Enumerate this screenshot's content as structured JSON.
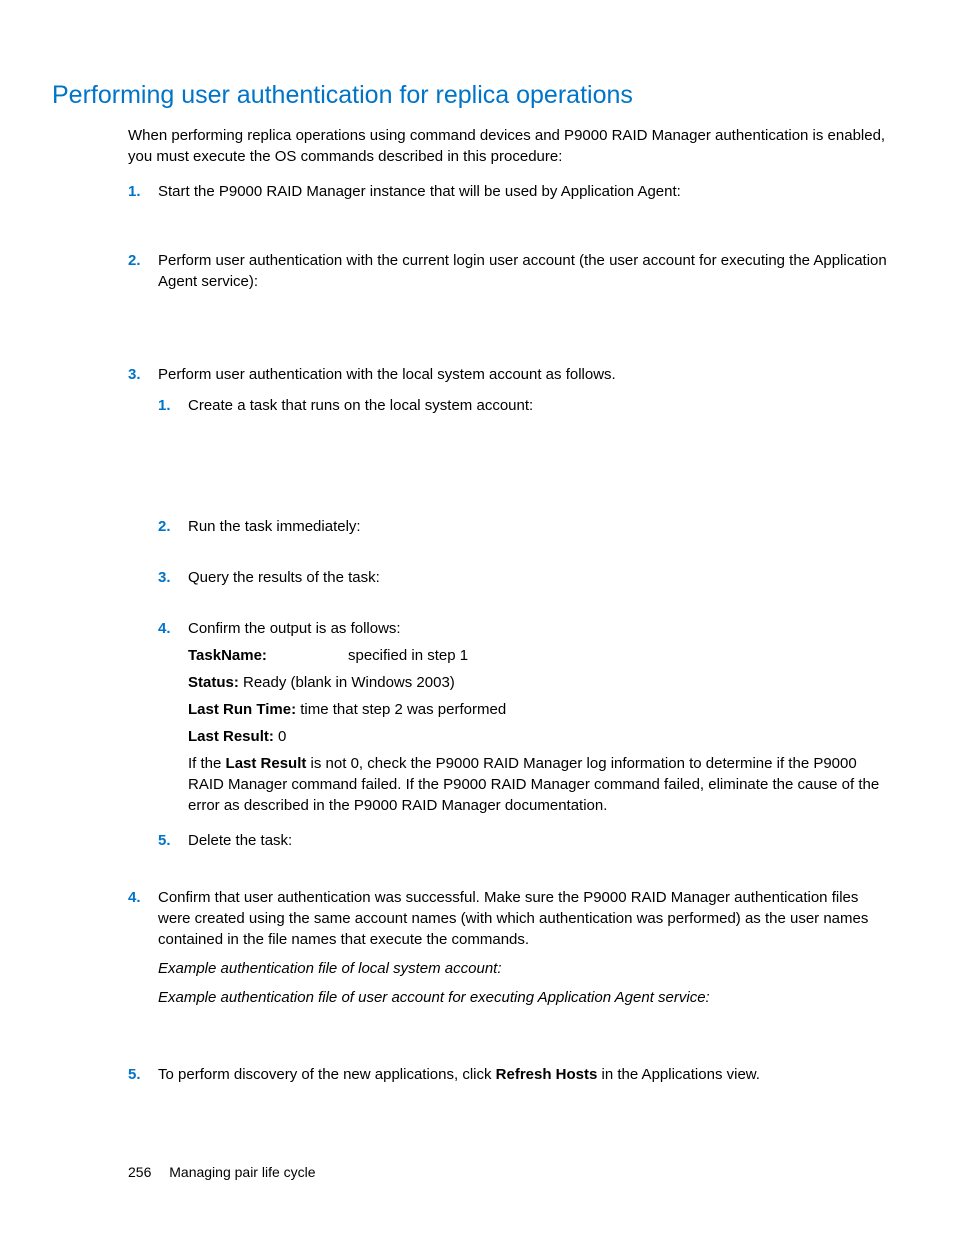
{
  "section_title": "Performing user authentication for replica operations",
  "intro": "When performing replica operations using command devices and P9000 RAID Manager authentication is enabled, you must execute the OS commands described in this procedure:",
  "steps": {
    "s1": {
      "num": "1.",
      "text": "Start the P9000 RAID Manager instance that will be used by Application Agent:"
    },
    "s2": {
      "num": "2.",
      "text": "Perform user authentication with the current login user account (the user account for executing the Application Agent service):"
    },
    "s3": {
      "num": "3.",
      "text": "Perform user authentication with the local system account as follows.",
      "sub": {
        "a": {
          "num": "1.",
          "text": "Create a task that runs on the local system account:"
        },
        "b": {
          "num": "2.",
          "text": "Run the task immediately:"
        },
        "c": {
          "num": "3.",
          "text": "Query the results of the task:"
        },
        "d": {
          "num": "4.",
          "text": "Confirm the output is as follows:",
          "taskname_label": "TaskName:",
          "taskname_value": "specified in step 1",
          "status_label": "Status:",
          "status_value": " Ready (blank in Windows 2003)",
          "lrt_label": "Last Run Time:",
          "lrt_value": " time that step 2 was performed",
          "lres_label": "Last Result:",
          "lres_value": " 0",
          "note_pre": "If the ",
          "note_bold": "Last Result",
          "note_post": " is not 0, check the P9000 RAID Manager log information to determine if the P9000 RAID Manager command failed. If the P9000 RAID Manager command failed, eliminate the cause of the error as described in the P9000 RAID Manager documentation."
        },
        "e": {
          "num": "5.",
          "text": "Delete the task:"
        }
      }
    },
    "s4": {
      "num": "4.",
      "text": "Confirm that user authentication was successful. Make sure the P9000 RAID Manager authentication files were created using the same account names (with which authentication was performed) as the user names contained in the file names that execute the commands.",
      "ex1": "Example authentication file of local system account:",
      "ex2": "Example authentication file of user account for executing Application Agent service:"
    },
    "s5": {
      "num": "5.",
      "pre": "To perform discovery of the new applications, click ",
      "bold": "Refresh Hosts",
      "post": " in the Applications view."
    }
  },
  "footer": {
    "page": "256",
    "chapter": "Managing pair life cycle"
  }
}
